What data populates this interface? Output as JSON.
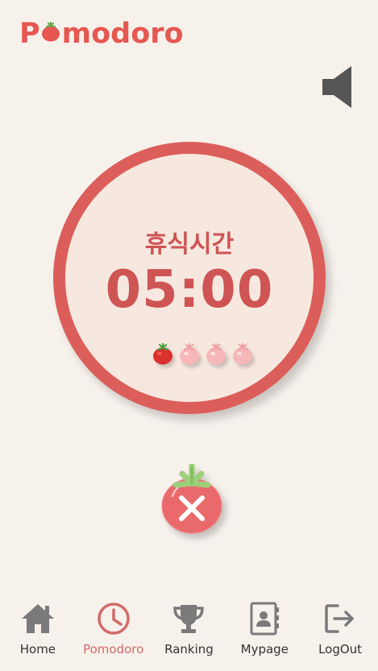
{
  "app": {
    "logo_prefix": "P",
    "logo_suffix": "modoro",
    "brand_color": "#e65751"
  },
  "header": {
    "sound_icon": "speaker-icon"
  },
  "timer": {
    "mode_label": "휴식시간",
    "time": "05:00",
    "sessions_completed": 1,
    "sessions_total": 4
  },
  "controls": {
    "cancel_icon": "tomato-x-icon"
  },
  "nav": {
    "items": [
      {
        "label": "Home",
        "icon": "house-icon",
        "active": false
      },
      {
        "label": "Pomodoro",
        "icon": "clock-icon",
        "active": true
      },
      {
        "label": "Ranking",
        "icon": "trophy-icon",
        "active": false
      },
      {
        "label": "Mypage",
        "icon": "contact-book-icon",
        "active": false
      },
      {
        "label": "LogOut",
        "icon": "logout-icon",
        "active": false
      }
    ]
  },
  "colors": {
    "accent": "#dc5e5a",
    "background": "#f7f1ec",
    "active_nav": "#d26b68",
    "icon_gray": "#7a7a7a"
  }
}
